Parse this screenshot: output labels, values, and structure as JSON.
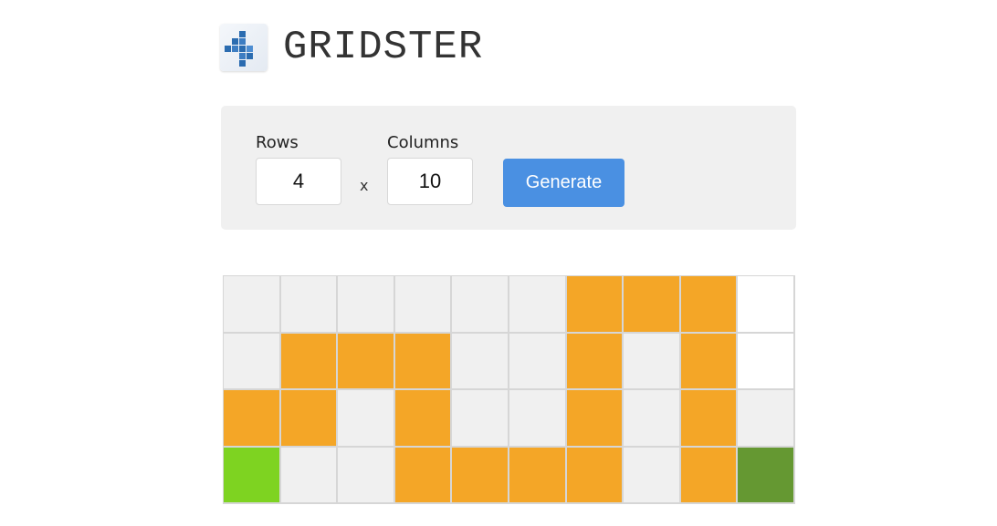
{
  "app": {
    "title": "GRIDSTER",
    "logo_icon": "grid-blocks-logo"
  },
  "form": {
    "rows_label": "Rows",
    "rows_value": "4",
    "columns_label": "Columns",
    "columns_value": "10",
    "times_symbol": "x",
    "generate_label": "Generate"
  },
  "colors": {
    "empty": "#f0f0f0",
    "path": "#f4a627",
    "open": "#ffffff",
    "start": "#7ed321",
    "end": "#659832",
    "button": "#4a90e2"
  },
  "grid": {
    "rows": 4,
    "columns": 10,
    "cells": [
      [
        "empty",
        "empty",
        "empty",
        "empty",
        "empty",
        "empty",
        "path",
        "path",
        "path",
        "open"
      ],
      [
        "empty",
        "path",
        "path",
        "path",
        "empty",
        "empty",
        "path",
        "empty",
        "path",
        "open"
      ],
      [
        "path",
        "path",
        "empty",
        "path",
        "empty",
        "empty",
        "path",
        "empty",
        "path",
        "empty"
      ],
      [
        "start",
        "empty",
        "empty",
        "path",
        "path",
        "path",
        "path",
        "empty",
        "path",
        "end"
      ]
    ]
  }
}
